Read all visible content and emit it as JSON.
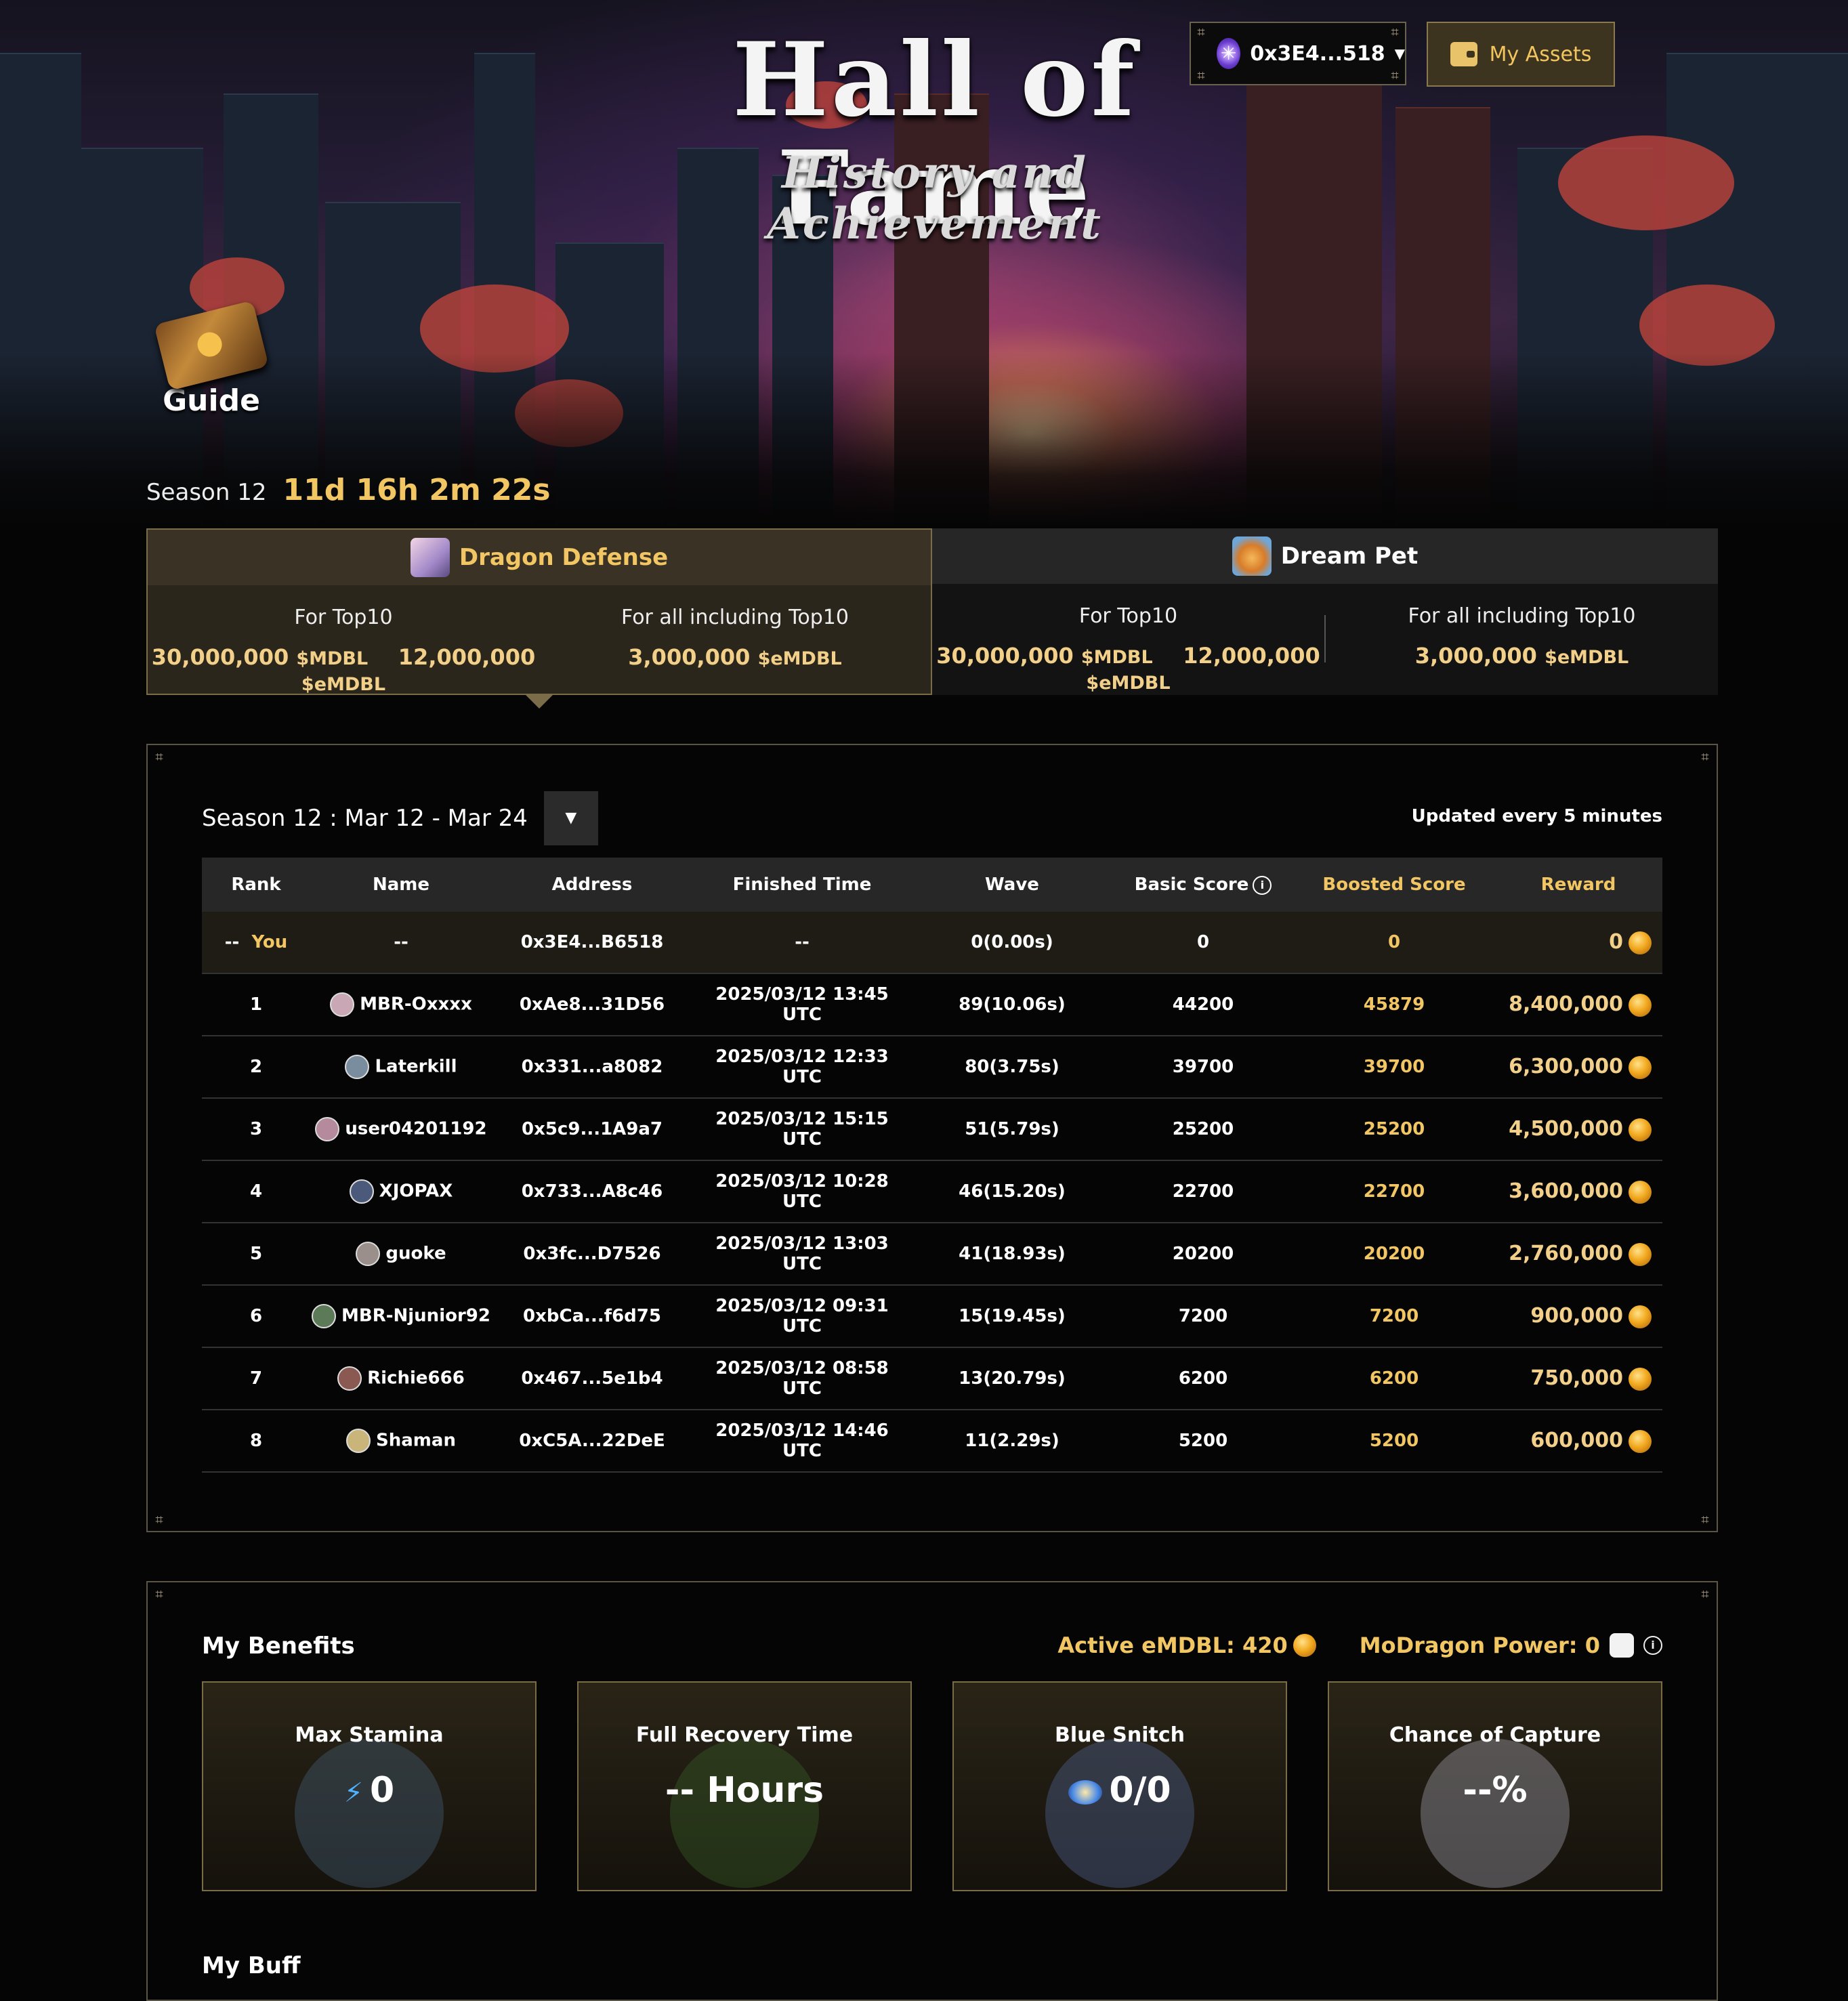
{
  "header": {
    "title": "Hall of Fame",
    "subtitle": "History and Achievement",
    "wallet_address": "0x3E4...518",
    "my_assets_label": "My Assets",
    "guide_label": "Guide",
    "season_label": "Season 12",
    "season_countdown": "11d 16h 2m 22s"
  },
  "games": [
    {
      "name": "Dragon Defense",
      "active": true,
      "top10_label": "For Top10",
      "top10_mdbl": "30,000,000",
      "top10_mdbl_unit": "$MDBL",
      "top10_emdbl": "12,000,000",
      "top10_emdbl_unit": "$eMDBL",
      "all_label": "For all including Top10",
      "all_emdbl": "3,000,000",
      "all_emdbl_unit": "$eMDBL"
    },
    {
      "name": "Dream Pet",
      "active": false,
      "top10_label": "For Top10",
      "top10_mdbl": "30,000,000",
      "top10_mdbl_unit": "$MDBL",
      "top10_emdbl": "12,000,000",
      "top10_emdbl_unit": "$eMDBL",
      "all_label": "For all including Top10",
      "all_emdbl": "3,000,000",
      "all_emdbl_unit": "$eMDBL"
    }
  ],
  "leaderboard": {
    "season_select": "Season 12 : Mar 12 - Mar 24",
    "updated_note": "Updated every 5 minutes",
    "columns": [
      "Rank",
      "Name",
      "Address",
      "Finished Time",
      "Wave",
      "Basic Score",
      "Boosted Score",
      "Reward"
    ],
    "you_row": {
      "rank": "--",
      "label": "You",
      "name": "--",
      "address": "0x3E4...B6518",
      "finished": "--",
      "wave": "0(0.00s)",
      "basic": "0",
      "boosted": "0",
      "reward": "0"
    },
    "rows": [
      {
        "rank": "1",
        "name": "MBR-Oxxxx",
        "address": "0xAe8...31D56",
        "finished": "2025/03/12 13:45 UTC",
        "wave": "89(10.06s)",
        "basic": "44200",
        "boosted": "45879",
        "reward": "8,400,000",
        "avatar_color": "#c9a7b5"
      },
      {
        "rank": "2",
        "name": "Laterkill",
        "address": "0x331...a8082",
        "finished": "2025/03/12 12:33 UTC",
        "wave": "80(3.75s)",
        "basic": "39700",
        "boosted": "39700",
        "reward": "6,300,000",
        "avatar_color": "#7a8d9e"
      },
      {
        "rank": "3",
        "name": "user04201192",
        "address": "0x5c9...1A9a7",
        "finished": "2025/03/12 15:15 UTC",
        "wave": "51(5.79s)",
        "basic": "25200",
        "boosted": "25200",
        "reward": "4,500,000",
        "avatar_color": "#b48a9c"
      },
      {
        "rank": "4",
        "name": "XJOPAX",
        "address": "0x733...A8c46",
        "finished": "2025/03/12 10:28 UTC",
        "wave": "46(15.20s)",
        "basic": "22700",
        "boosted": "22700",
        "reward": "3,600,000",
        "avatar_color": "#4b5a7a"
      },
      {
        "rank": "5",
        "name": "guoke",
        "address": "0x3fc...D7526",
        "finished": "2025/03/12 13:03 UTC",
        "wave": "41(18.93s)",
        "basic": "20200",
        "boosted": "20200",
        "reward": "2,760,000",
        "avatar_color": "#9a8f8a"
      },
      {
        "rank": "6",
        "name": "MBR-Njunior92",
        "address": "0xbCa...f6d75",
        "finished": "2025/03/12 09:31 UTC",
        "wave": "15(19.45s)",
        "basic": "7200",
        "boosted": "7200",
        "reward": "900,000",
        "avatar_color": "#5d7a58"
      },
      {
        "rank": "7",
        "name": "Richie666",
        "address": "0x467...5e1b4",
        "finished": "2025/03/12 08:58 UTC",
        "wave": "13(20.79s)",
        "basic": "6200",
        "boosted": "6200",
        "reward": "750,000",
        "avatar_color": "#8a5a52"
      },
      {
        "rank": "8",
        "name": "Shaman",
        "address": "0xC5A...22DeE",
        "finished": "2025/03/12 14:46 UTC",
        "wave": "11(2.29s)",
        "basic": "5200",
        "boosted": "5200",
        "reward": "600,000",
        "avatar_color": "#c9b57a"
      }
    ]
  },
  "benefits": {
    "title": "My Benefits",
    "active_emdbl": "Active eMDBL: 420",
    "modragon_power": "MoDragon Power: 0",
    "cards": [
      {
        "title": "Max Stamina",
        "value": "0",
        "icon": "lightning-icon"
      },
      {
        "title": "Full Recovery Time",
        "value": "-- Hours",
        "icon": "none"
      },
      {
        "title": "Blue Snitch",
        "value": "0/0",
        "icon": "snitch-icon"
      },
      {
        "title": "Chance of Capture",
        "value": "--%",
        "icon": "none"
      }
    ],
    "my_buff_label": "My Buff"
  },
  "colors": {
    "gold": "#f3c664",
    "panel_border": "#7b6c49",
    "background": "#050505"
  }
}
